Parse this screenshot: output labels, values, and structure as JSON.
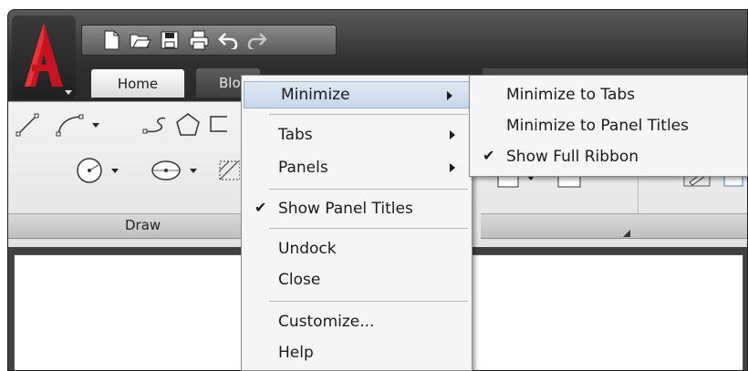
{
  "app": {
    "logo_letter": "A"
  },
  "ribbon": {
    "tabs": [
      {
        "label": "Home",
        "active": true
      },
      {
        "label": "Blo",
        "active": false
      }
    ],
    "panels": [
      {
        "title": "Draw"
      }
    ]
  },
  "context_menu": {
    "items": [
      {
        "label": "Minimize",
        "has_submenu": true,
        "highlighted": true
      },
      {
        "label": "Tabs",
        "has_submenu": true
      },
      {
        "label": "Panels",
        "has_submenu": true
      },
      {
        "label": "Show Panel Titles",
        "checked": true
      },
      {
        "label": "Undock"
      },
      {
        "label": "Close"
      },
      {
        "label": "Customize..."
      },
      {
        "label": "Help"
      }
    ]
  },
  "submenu": {
    "items": [
      {
        "label": "Minimize to Tabs"
      },
      {
        "label": "Minimize to Panel Titles"
      },
      {
        "label": "Show Full Ribbon",
        "checked": true
      }
    ]
  },
  "colors": {
    "logo_red": "#c8141e",
    "menu_highlight": "#c6d6ec",
    "frame_dark": "#404040"
  }
}
